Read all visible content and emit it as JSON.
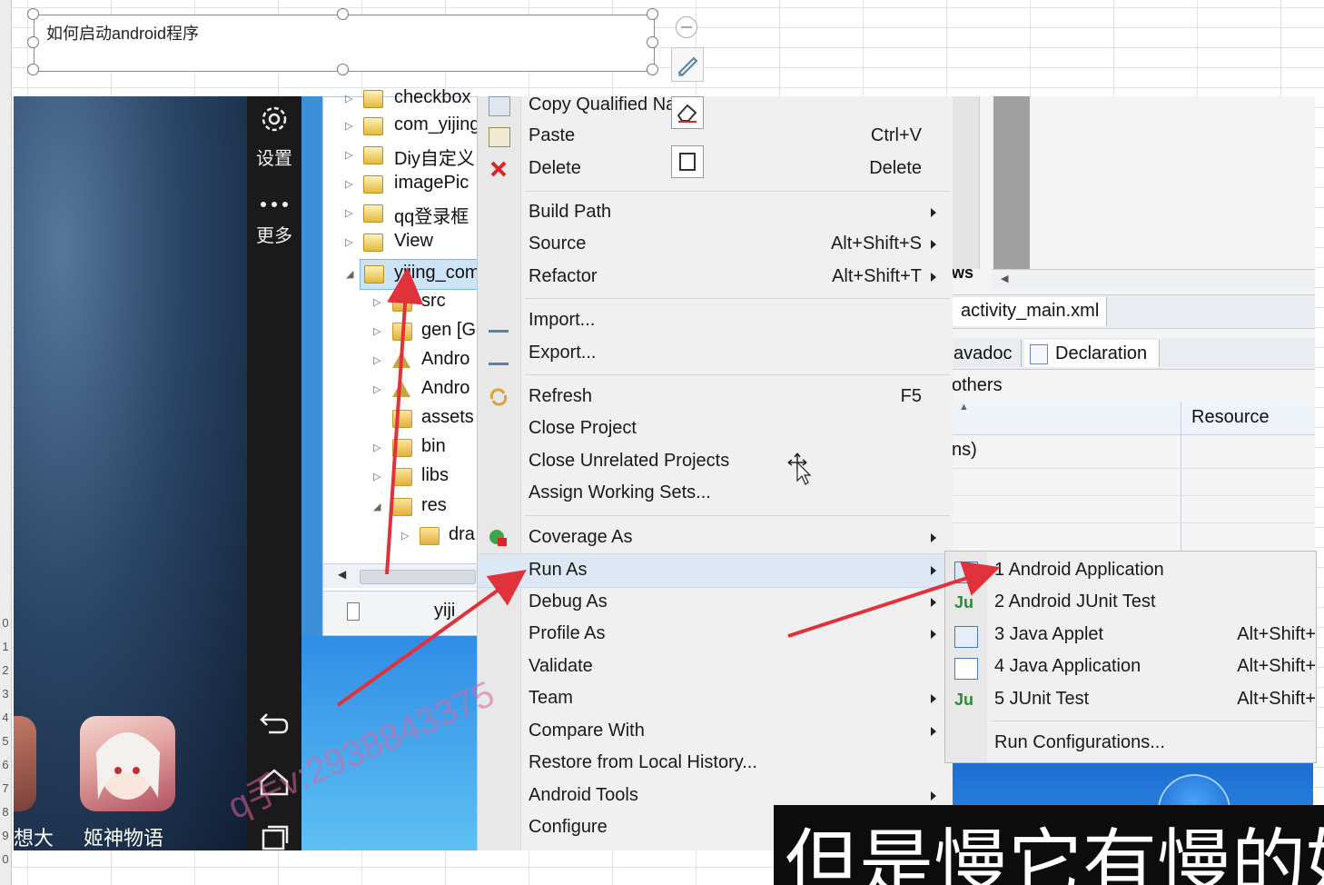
{
  "textbox": {
    "text": "如何启动android程序"
  },
  "row_numbers": [
    "0",
    "1",
    "2",
    "3",
    "4",
    "5",
    "6",
    "7",
    "8",
    "9",
    "0"
  ],
  "phone": {
    "settings_label": "设置",
    "more_label": "更多",
    "apps": [
      {
        "label": "想大"
      },
      {
        "label": "姬神物语"
      }
    ]
  },
  "explorer": {
    "items": [
      {
        "label": "checkbox"
      },
      {
        "label": "com_yijing"
      },
      {
        "label": "Diy自定义"
      },
      {
        "label": "imagePic"
      },
      {
        "label": "qq登录框"
      },
      {
        "label": "View"
      },
      {
        "label": "yijing_com"
      },
      {
        "label": "src"
      },
      {
        "label": "gen [G"
      },
      {
        "label": "Andro"
      },
      {
        "label": "Andro"
      },
      {
        "label": "assets"
      },
      {
        "label": "bin"
      },
      {
        "label": "libs"
      },
      {
        "label": "res"
      },
      {
        "label": "dra"
      }
    ],
    "bottom_label": "yiji"
  },
  "context_menu": {
    "items": [
      {
        "label": "Copy Qualified Name",
        "shortcut": ""
      },
      {
        "label": "Paste",
        "shortcut": "Ctrl+V"
      },
      {
        "label": "Delete",
        "shortcut": "Delete"
      },
      {
        "label": "Build Path",
        "shortcut": ""
      },
      {
        "label": "Source",
        "shortcut": "Alt+Shift+S"
      },
      {
        "label": "Refactor",
        "shortcut": "Alt+Shift+T"
      },
      {
        "label": "Import...",
        "shortcut": ""
      },
      {
        "label": "Export...",
        "shortcut": ""
      },
      {
        "label": "Refresh",
        "shortcut": "F5"
      },
      {
        "label": "Close Project",
        "shortcut": ""
      },
      {
        "label": "Close Unrelated Projects",
        "shortcut": ""
      },
      {
        "label": "Assign Working Sets...",
        "shortcut": ""
      },
      {
        "label": "Coverage As",
        "shortcut": ""
      },
      {
        "label": "Run As",
        "shortcut": ""
      },
      {
        "label": "Debug As",
        "shortcut": ""
      },
      {
        "label": "Profile As",
        "shortcut": ""
      },
      {
        "label": "Validate",
        "shortcut": ""
      },
      {
        "label": "Team",
        "shortcut": ""
      },
      {
        "label": "Compare With",
        "shortcut": ""
      },
      {
        "label": "Restore from Local History...",
        "shortcut": ""
      },
      {
        "label": "Android Tools",
        "shortcut": ""
      },
      {
        "label": "Configure",
        "shortcut": ""
      }
    ]
  },
  "submenu": {
    "items": [
      {
        "label": "1 Android Application",
        "shortcut": ""
      },
      {
        "label": "2 Android JUnit Test",
        "shortcut": ""
      },
      {
        "label": "3 Java Applet",
        "shortcut": "Alt+Shift+"
      },
      {
        "label": "4 Java Application",
        "shortcut": "Alt+Shift+"
      },
      {
        "label": "5 JUnit Test",
        "shortcut": "Alt+Shift+"
      },
      {
        "label": "Run Configurations...",
        "shortcut": ""
      }
    ]
  },
  "right_panel": {
    "ws_label": "ws",
    "editor_tab": "activity_main.xml",
    "tab_javadoc": "avadoc",
    "tab_declaration": "Declaration",
    "others_label": "others",
    "resource_header": "Resource",
    "row_text": "ns)"
  },
  "caption": {
    "text": "但是慢它有慢的好"
  },
  "watermark": {
    "text": "q手v:2938843375"
  },
  "colors": {
    "arrow": "#e0323a",
    "selection": "#dde8f4",
    "caption_bg": "#0c0c0c"
  }
}
